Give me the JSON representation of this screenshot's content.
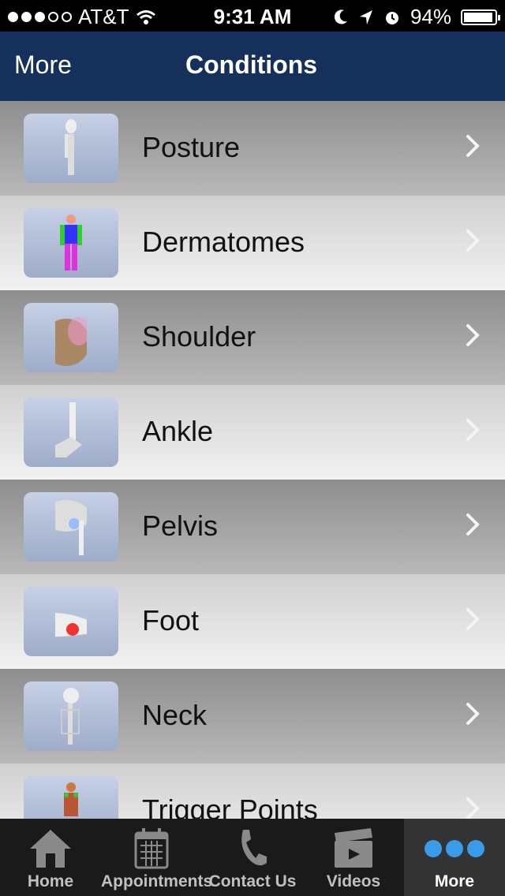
{
  "status_bar": {
    "carrier": "AT&T",
    "time": "9:31 AM",
    "battery_percent": "94%",
    "battery_level": 0.94,
    "signal_bars": 3
  },
  "nav": {
    "back_label": "More",
    "title": "Conditions"
  },
  "conditions": [
    {
      "label": "Posture",
      "thumb_icon": "skeleton-side-icon"
    },
    {
      "label": "Dermatomes",
      "thumb_icon": "dermatome-body-icon"
    },
    {
      "label": "Shoulder",
      "thumb_icon": "shoulder-icon"
    },
    {
      "label": "Ankle",
      "thumb_icon": "ankle-icon"
    },
    {
      "label": "Pelvis",
      "thumb_icon": "pelvis-icon"
    },
    {
      "label": "Foot",
      "thumb_icon": "foot-icon"
    },
    {
      "label": "Neck",
      "thumb_icon": "neck-icon"
    },
    {
      "label": "Trigger Points",
      "thumb_icon": "trigger-points-icon"
    }
  ],
  "tabs": [
    {
      "label": "Home",
      "icon": "home-icon"
    },
    {
      "label": "Appointments",
      "icon": "calendar-icon"
    },
    {
      "label": "Contact Us",
      "icon": "phone-icon"
    },
    {
      "label": "Videos",
      "icon": "clapperboard-icon"
    },
    {
      "label": "More",
      "icon": "more-dots-icon"
    }
  ],
  "colors": {
    "nav_background": "#15305a",
    "tab_background": "#1a1a1a",
    "more_dots": "#3a9be8"
  }
}
